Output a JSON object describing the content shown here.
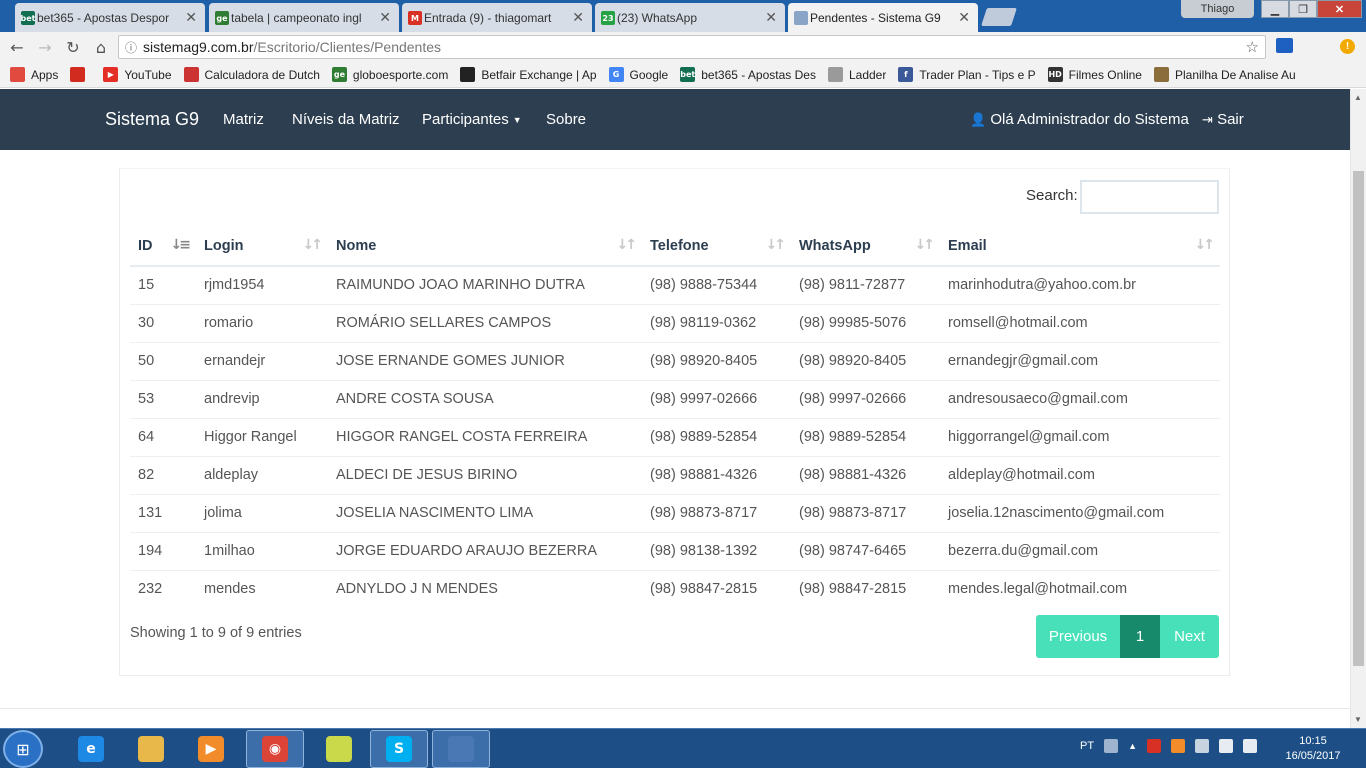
{
  "browser": {
    "tabs": [
      {
        "label": "bet365 - Apostas Despor",
        "favicon": "bet365-icon",
        "color": "#126e51",
        "active": false
      },
      {
        "label": "tabela | campeonato ingl",
        "favicon": "globoesporte-icon",
        "color": "#2f7d32",
        "active": false
      },
      {
        "label": "Entrada (9) - thiagomart",
        "favicon": "gmail-icon",
        "color": "#d93025",
        "active": false
      },
      {
        "label": "(23) WhatsApp",
        "favicon": "whatsapp-icon",
        "color": "#25a244",
        "active": false
      },
      {
        "label": "Pendentes - Sistema G9",
        "favicon": "page-icon",
        "color": "#8aa4c8",
        "active": true
      }
    ],
    "tab_favicon_text": [
      "bet",
      "ge",
      "M",
      "23",
      ""
    ],
    "user_name": "Thiago",
    "address": {
      "host": "sistemag9.com.br",
      "path": "/Escritorio/Clientes/Pendentes"
    },
    "bookmarks": [
      {
        "label": "Apps",
        "icon": "apps-grid-icon",
        "color": "#e04a3f",
        "text": ""
      },
      {
        "label": "",
        "icon": "red-bars-icon",
        "color": "#d12b1f",
        "text": ""
      },
      {
        "label": "YouTube",
        "icon": "youtube-icon",
        "color": "#e52d27",
        "text": "▶"
      },
      {
        "label": "Calculadora de Dutch",
        "icon": "calculator-icon",
        "color": "#c33",
        "text": ""
      },
      {
        "label": "globoesporte.com",
        "icon": "globoesporte-icon",
        "color": "#2f7d32",
        "text": "ge"
      },
      {
        "label": "Betfair Exchange | Ap",
        "icon": "betfair-icon",
        "color": "#222",
        "text": ""
      },
      {
        "label": "Google",
        "icon": "google-icon",
        "color": "#4285f4",
        "text": "G"
      },
      {
        "label": "bet365 - Apostas Des",
        "icon": "bet365-icon",
        "color": "#126e51",
        "text": "bet"
      },
      {
        "label": "Ladder",
        "icon": "page-icon",
        "color": "#9a9a9a",
        "text": ""
      },
      {
        "label": "Trader Plan - Tips e P",
        "icon": "facebook-icon",
        "color": "#3b5998",
        "text": "f"
      },
      {
        "label": "Filmes Online",
        "icon": "filmes-icon",
        "color": "#333",
        "text": "HD"
      },
      {
        "label": "Planilha De Analise Au",
        "icon": "planilha-icon",
        "color": "#8a6d3b",
        "text": ""
      }
    ]
  },
  "navbar": {
    "brand": "Sistema G9",
    "items": [
      "Matriz",
      "Níveis da Matriz",
      "Participantes",
      "Sobre"
    ],
    "user_greeting": "Olá Administrador do Sistema",
    "logout": "Sair"
  },
  "table": {
    "search_label": "Search:",
    "search_value": "",
    "columns": [
      "ID",
      "Login",
      "Nome",
      "Telefone",
      "WhatsApp",
      "Email"
    ],
    "rows": [
      [
        "15",
        "rjmd1954",
        "RAIMUNDO JOAO MARINHO DUTRA",
        "(98) 9888-75344",
        "(98) 9811-72877",
        "marinhodutra@yahoo.com.br"
      ],
      [
        "30",
        "romario",
        "ROMÁRIO SELLARES CAMPOS",
        "(98) 98119-0362",
        "(98) 99985-5076",
        "romsell@hotmail.com"
      ],
      [
        "50",
        "ernandejr",
        "JOSE ERNANDE GOMES JUNIOR",
        "(98) 98920-8405",
        "(98) 98920-8405",
        "ernandegjr@gmail.com"
      ],
      [
        "53",
        "andrevip",
        "ANDRE COSTA SOUSA",
        "(98) 9997-02666",
        "(98) 9997-02666",
        "andresousaeco@gmail.com"
      ],
      [
        "64",
        "Higgor Rangel",
        "HIGGOR RANGEL COSTA FERREIRA",
        "(98) 9889-52854",
        "(98) 9889-52854",
        "higgorrangel@gmail.com"
      ],
      [
        "82",
        "aldeplay",
        "ALDECI DE JESUS BIRINO",
        "(98) 98881-4326",
        "(98) 98881-4326",
        "aldeplay@hotmail.com"
      ],
      [
        "131",
        "jolima",
        "JOSELIA NASCIMENTO LIMA",
        "(98) 98873-8717",
        "(98) 98873-8717",
        "joselia.12nascimento@gmail.com"
      ],
      [
        "194",
        "1milhao",
        "JORGE EDUARDO ARAUJO BEZERRA",
        "(98) 98138-1392",
        "(98) 98747-6465",
        "bezerra.du@gmail.com"
      ],
      [
        "232",
        "mendes",
        "ADNYLDO J N MENDES",
        "(98) 98847-2815",
        "(98) 98847-2815",
        "mendes.legal@hotmail.com"
      ]
    ],
    "info": "Showing 1 to 9 of 9 entries",
    "pagination": {
      "previous": "Previous",
      "current": "1",
      "next": "Next"
    }
  },
  "taskbar": {
    "apps": [
      {
        "name": "internet-explorer-icon",
        "color": "#1e88e5",
        "text": "e"
      },
      {
        "name": "file-explorer-icon",
        "color": "#e8b84a",
        "text": ""
      },
      {
        "name": "media-player-icon",
        "color": "#f28b2a",
        "text": "▶"
      },
      {
        "name": "chrome-icon",
        "color": "#db4437",
        "text": "◉"
      },
      {
        "name": "sticky-notes-icon",
        "color": "#c9d94a",
        "text": ""
      },
      {
        "name": "skype-icon",
        "color": "#00aff0",
        "text": "S"
      },
      {
        "name": "remote-desktop-icon",
        "color": "#4a78b5",
        "text": ""
      }
    ],
    "language": "PT",
    "time": "10:15",
    "date": "16/05/2017"
  },
  "colors": {
    "navbar_bg": "#2c3e50",
    "accent": "#48e0b8",
    "accent_active": "#168a6a",
    "taskbar_bg": "#1d4f86"
  }
}
